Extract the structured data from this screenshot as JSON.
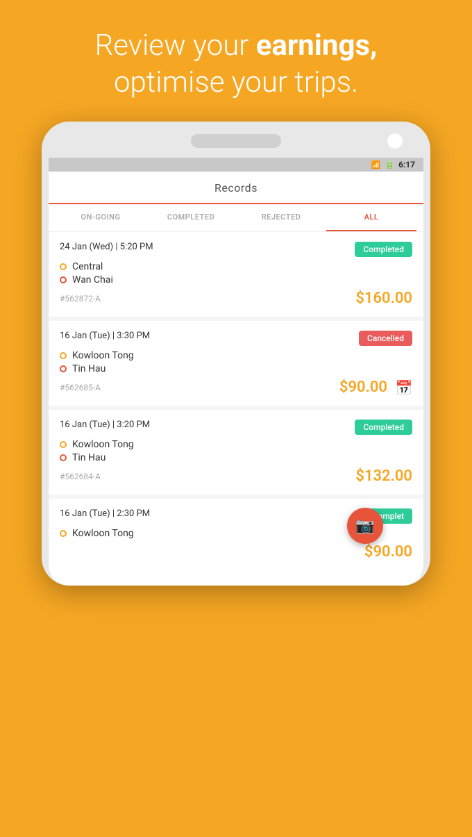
{
  "hero": {
    "line1": "Review your ",
    "line1_bold": "earnings,",
    "line2": "optimise your trips."
  },
  "status_bar": {
    "time": "6:17"
  },
  "app_header": {
    "title": "Records"
  },
  "tabs": [
    {
      "id": "ongoing",
      "label": "ON-GOING",
      "active": false
    },
    {
      "id": "completed",
      "label": "COMPLETED",
      "active": false
    },
    {
      "id": "rejected",
      "label": "REJECTED",
      "active": false
    },
    {
      "id": "all",
      "label": "ALL",
      "active": true
    }
  ],
  "records": [
    {
      "id": "record-1",
      "datetime": "24 Jan (Wed) | 5:20 PM",
      "status": "Completed",
      "status_type": "completed",
      "from": "Central",
      "to": "Wan Chai",
      "order_id": "#562872-A",
      "amount": "$160.00",
      "has_calendar": false
    },
    {
      "id": "record-2",
      "datetime": "16 Jan (Tue) | 3:30 PM",
      "status": "Cancelled",
      "status_type": "cancelled",
      "from": "Kowloon Tong",
      "to": "Tin Hau",
      "order_id": "#562685-A",
      "amount": "$90.00",
      "has_calendar": true
    },
    {
      "id": "record-3",
      "datetime": "16 Jan (Tue) | 3:20 PM",
      "status": "Completed",
      "status_type": "completed",
      "from": "Kowloon Tong",
      "to": "Tin Hau",
      "order_id": "#562684-A",
      "amount": "$132.00",
      "has_calendar": false
    },
    {
      "id": "record-4",
      "datetime": "16 Jan (Tue) | 2:30 PM",
      "status": "Complet",
      "status_type": "completed",
      "from": "Kowloon Tong",
      "to": "",
      "order_id": "",
      "amount": "$90.00",
      "has_calendar": false,
      "partial": true
    }
  ],
  "fab": {
    "icon": "📷"
  }
}
